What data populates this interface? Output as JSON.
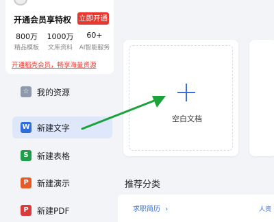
{
  "member": {
    "title": "开通会员享特权",
    "cta": "立即开通",
    "stats": [
      {
        "value": "800万",
        "label": "精品模板"
      },
      {
        "value": "1000万",
        "label": "文库资料"
      },
      {
        "value": "60+",
        "label": "AI智能服务"
      }
    ],
    "promo_link": "开通稻壳会员，畅享海量资源"
  },
  "sidebar": {
    "items": [
      {
        "label": "我的资源",
        "icon": "star-icon",
        "color": "#8e99ad",
        "glyph": "☆"
      },
      {
        "label": "新建文字",
        "icon": "word-icon",
        "color": "#2c6ddb",
        "glyph": "W"
      },
      {
        "label": "新建表格",
        "icon": "sheet-icon",
        "color": "#1e9e4a",
        "glyph": "S"
      },
      {
        "label": "新建演示",
        "icon": "presentation-icon",
        "color": "#e55b2a",
        "glyph": "P"
      },
      {
        "label": "新建PDF",
        "icon": "pdf-icon",
        "color": "#d93a3a",
        "glyph": "P"
      }
    ]
  },
  "main": {
    "blank_doc_label": "空白文档",
    "section_title": "推荐分类",
    "recommend_link": "求职简历",
    "recommend_right": "人资"
  },
  "colors": {
    "accent": "#3a6fd8",
    "brand_red": "#e8372f",
    "arrow_green": "#1aa33a",
    "active_bg": "#dfe7fb"
  }
}
